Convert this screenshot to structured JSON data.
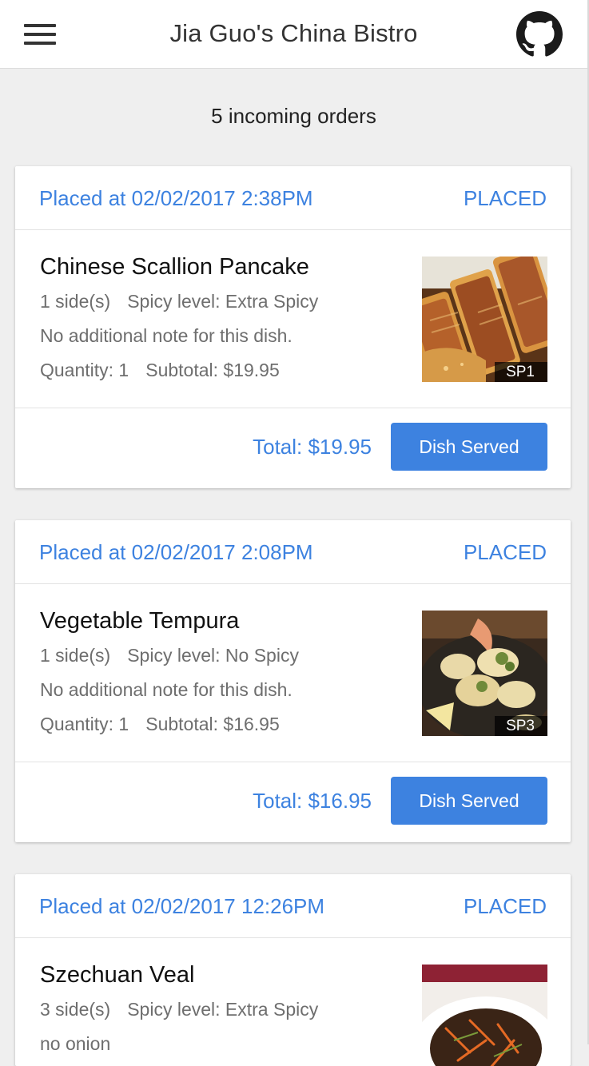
{
  "app": {
    "title": "Jia Guo's China Bistro"
  },
  "orders_summary": "5 incoming orders",
  "orders": [
    {
      "placed_at": "Placed at 02/02/2017 2:38PM",
      "status": "PLACED",
      "dish_name": "Chinese Scallion Pancake",
      "sides": "1 side(s)",
      "spicy": "Spicy level: Extra Spicy",
      "note": "No additional note for this dish.",
      "quantity": "Quantity: 1",
      "subtotal": "Subtotal: $19.95",
      "photo_code": "SP1",
      "total": "Total: $19.95",
      "action_label": "Dish Served"
    },
    {
      "placed_at": "Placed at 02/02/2017 2:08PM",
      "status": "PLACED",
      "dish_name": "Vegetable Tempura",
      "sides": "1 side(s)",
      "spicy": "Spicy level: No Spicy",
      "note": "No additional note for this dish.",
      "quantity": "Quantity: 1",
      "subtotal": "Subtotal: $16.95",
      "photo_code": "SP3",
      "total": "Total: $16.95",
      "action_label": "Dish Served"
    },
    {
      "placed_at": "Placed at 02/02/2017 12:26PM",
      "status": "PLACED",
      "dish_name": "Szechuan Veal",
      "sides": "3 side(s)",
      "spicy": "Spicy level: Extra Spicy",
      "note": "no onion"
    }
  ],
  "icons": {
    "menu": "hamburger-menu-icon",
    "github": "github-icon"
  },
  "colors": {
    "accent": "#3d82e0",
    "background": "#efefef",
    "appbar": "#ffffff",
    "button_text": "#ffffff"
  }
}
